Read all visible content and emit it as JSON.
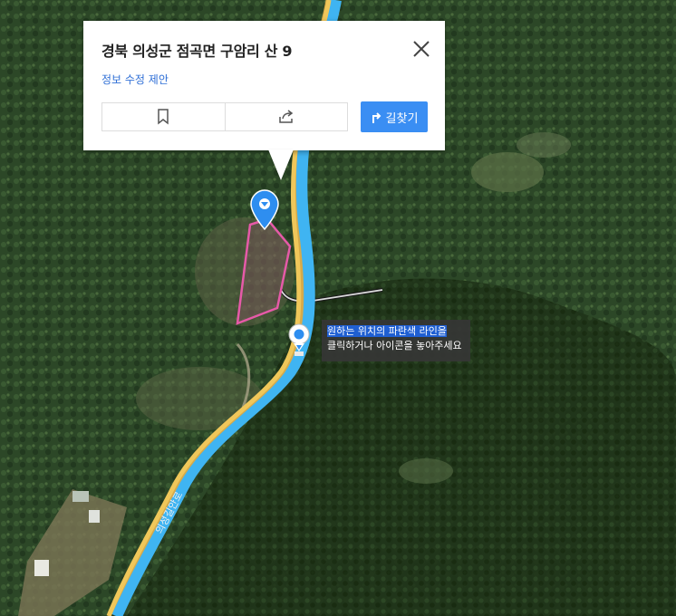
{
  "popup": {
    "title": "경북 의성군 점곡면 구암리 산 9",
    "edit_link": "정보 수정 제안",
    "route_label": "길찾기",
    "bookmark_icon": "bookmark-icon",
    "share_icon": "share-icon",
    "close_icon": "close-icon"
  },
  "tooltip": {
    "line1": "원하는 위치의 파란색 라인을",
    "line2": "클릭하거나 아이콘을 놓아주세요"
  },
  "map": {
    "road_label": "의성길안로",
    "colors": {
      "road_outline": "#3fb4f2",
      "road_fill": "#f0c75a",
      "parcel": "#e65aa8",
      "pin": "#2e8ef0"
    }
  }
}
